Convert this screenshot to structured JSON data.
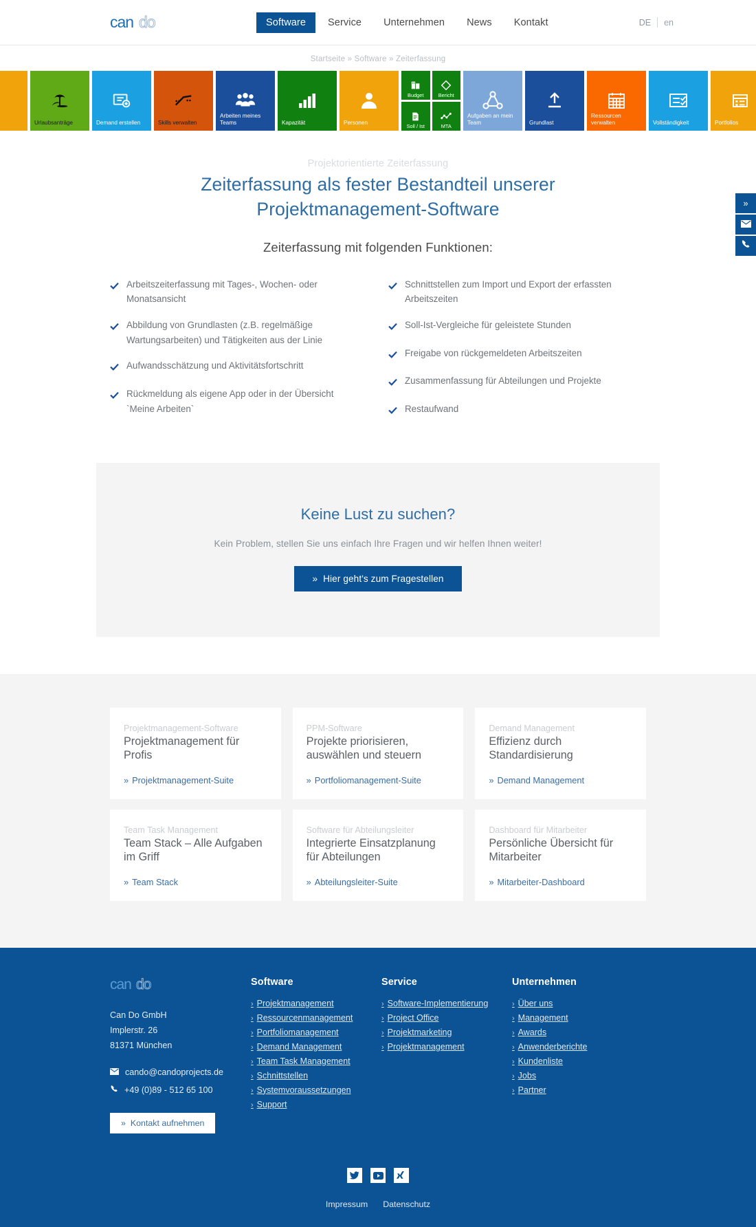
{
  "header": {
    "logo_text": "cando",
    "nav": [
      {
        "label": "Software",
        "active": true
      },
      {
        "label": "Service",
        "active": false
      },
      {
        "label": "Unternehmen",
        "active": false
      },
      {
        "label": "News",
        "active": false
      },
      {
        "label": "Kontakt",
        "active": false
      }
    ],
    "lang_current": "DE",
    "lang_alt": "en"
  },
  "breadcrumb": {
    "items": [
      "Startseite",
      "Software",
      "Zeiterfassung"
    ],
    "separator": "»",
    "full": "Startseite » Software » Zeiterfassung"
  },
  "tiles": [
    {
      "label": "",
      "color": "#f0a30a",
      "icon": "edge-left",
      "text_dark": false,
      "edge": true
    },
    {
      "label": "Urlaubsanträge",
      "color": "#60a917",
      "icon": "palm-tree-icon",
      "text_dark": true
    },
    {
      "label": "Demand erstellen",
      "color": "#1ba1e2",
      "icon": "form-add-icon",
      "text_dark": false
    },
    {
      "label": "Skills verwalten",
      "color": "#d4540b",
      "icon": "trend-line-icon",
      "text_dark": true
    },
    {
      "label": "Arbeiten meines Teams",
      "color": "#1b4f9c",
      "icon": "team-group-icon",
      "text_dark": false
    },
    {
      "label": "Kapazität",
      "color": "#108010",
      "icon": "bar-chart-icon",
      "text_dark": false
    },
    {
      "label": "Personen",
      "color": "#f0a30a",
      "icon": "person-icon",
      "text_dark": false
    },
    {
      "label": "Grundlast",
      "color": "#1b4f9c",
      "icon": "upload-arrow-icon",
      "text_dark": false
    },
    {
      "label": "Ressourcen verwalten",
      "color": "#fa6800",
      "icon": "calendar-grid-icon",
      "text_dark": false
    },
    {
      "label": "Vollständigkeit",
      "color": "#1ba1e2",
      "icon": "checklist-icon",
      "text_dark": false
    },
    {
      "label": "Portfolios",
      "color": "#f0a30a",
      "icon": "portfolio-board-icon",
      "text_dark": false
    },
    {
      "label": "",
      "color": "#108010",
      "icon": "edge-right",
      "text_dark": false,
      "edge": true
    }
  ],
  "tile_group": [
    {
      "label": "Budget",
      "color": "#108010",
      "icon": "budget-book-icon"
    },
    {
      "label": "Bericht",
      "color": "#108010",
      "icon": "diamond-report-icon"
    },
    {
      "label": "Soll / Ist",
      "color": "#108010",
      "icon": "document-icon"
    },
    {
      "label": "MTA",
      "color": "#108010",
      "icon": "scatter-trend-icon"
    }
  ],
  "tile_wide": {
    "label": "Aufgaben an mein Team",
    "color": "#7da7d9",
    "icon": "share-nodes-icon"
  },
  "hero": {
    "eyebrow": "Projektorientierte Zeiterfassung",
    "title_line1": "Zeiterfassung als fester Bestandteil unserer",
    "title_line2": "Projektmanagement-Software",
    "subtitle": "Zeiterfassung mit folgenden Funktionen:"
  },
  "features": {
    "left": [
      "Arbeitszeiterfassung mit Tages-, Wochen- oder Monatsansicht",
      "Abbildung von Grundlasten (z.B. regelmäßige Wartungsarbeiten) und Tätigkeiten aus der Linie",
      "Aufwandsschätzung und Aktivitätsfortschritt",
      "Rückmeldung als eigene App oder in der Übersicht `Meine Arbeiten`"
    ],
    "right": [
      "Schnittstellen zum Import und Export der erfassten Arbeitszeiten",
      "Soll-Ist-Vergleiche für geleistete Stunden",
      "Freigabe von rückgemeldeten Arbeitszeiten",
      "Zusammenfassung für Abteilungen und Projekte",
      "Restaufwand"
    ]
  },
  "cta": {
    "heading": "Keine Lust zu suchen?",
    "text": "Kein Problem, stellen Sie uns einfach Ihre Fragen und wir helfen Ihnen weiter!",
    "button": "Hier geht's zum Fragestellen",
    "chevron": "»"
  },
  "cards": [
    {
      "kicker": "Projektmanagement-Software",
      "title": "Projektmanagement für Profis",
      "link": "Projektmanagement-Suite"
    },
    {
      "kicker": "PPM-Software",
      "title": "Projekte priorisieren, auswählen und steuern",
      "link": "Portfoliomanagement-Suite"
    },
    {
      "kicker": "Demand Management",
      "title": "Effizienz durch Standardisierung",
      "link": "Demand Management"
    },
    {
      "kicker": "Team Task Management",
      "title": "Team Stack – Alle Aufgaben im Griff",
      "link": "Team Stack"
    },
    {
      "kicker": "Software für Abteilungsleiter",
      "title": "Integrierte Einsatzplanung für Abteilungen",
      "link": "Abteilungsleiter-Suite"
    },
    {
      "kicker": "Dashboard für Mitarbeiter",
      "title": "Persönliche Übersicht für Mitarbeiter",
      "link": "Mitarbeiter-Dashboard"
    }
  ],
  "footer": {
    "logo_text": "cando",
    "company": "Can Do GmbH",
    "street": "Implerstr. 26",
    "city": "81371 München",
    "email": "cando@candoprojects.de",
    "phone": "+49 (0)89 - 512 65 100",
    "contact_button": "Kontakt aufnehmen",
    "chevron": "»",
    "columns": [
      {
        "heading": "Software",
        "links": [
          "Projektmanagement",
          "Ressourcenmanagement",
          "Portfoliomanagement",
          "Demand Management",
          "Team Task Management",
          "Schnittstellen",
          "Systemvoraussetzungen",
          "Support"
        ]
      },
      {
        "heading": "Service",
        "links": [
          "Software-Implementierung",
          "Project Office",
          "Projektmarketing",
          "Projektmanagement"
        ]
      },
      {
        "heading": "Unternehmen",
        "links": [
          "Über uns",
          "Management",
          "Awards",
          "Anwenderberichte",
          "Kundenliste",
          "Jobs",
          "Partner"
        ]
      }
    ],
    "social": [
      "twitter-icon",
      "youtube-icon",
      "xing-icon"
    ],
    "legal": [
      "Impressum",
      "Datenschutz"
    ]
  },
  "side_buttons": [
    {
      "icon": "double-chevron-right-icon"
    },
    {
      "icon": "mail-icon"
    },
    {
      "icon": "phone-icon"
    }
  ],
  "colors": {
    "brand_blue": "#0b5394",
    "heading_blue": "#2e6da4",
    "link_blue": "#3a6ea5",
    "light_grey_bg": "#f4f4f4"
  }
}
